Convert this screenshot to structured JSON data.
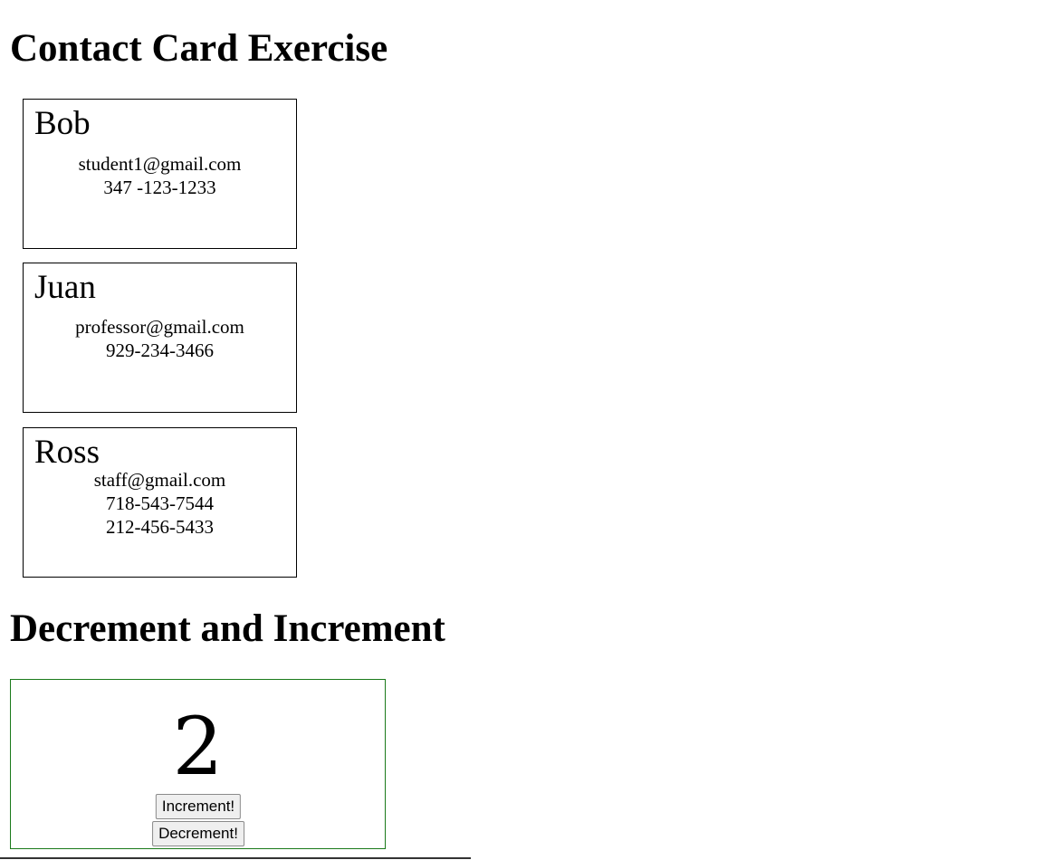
{
  "page_title": "Contact Card Exercise",
  "contacts": [
    {
      "name": "Bob",
      "lines": [
        "student1@gmail.com",
        "347 -123-1233"
      ]
    },
    {
      "name": "Juan",
      "lines": [
        "professor@gmail.com",
        "929-234-3466"
      ]
    },
    {
      "name": "Ross",
      "lines": [
        "staff@gmail.com",
        "718-543-7544",
        "212-456-5433"
      ]
    }
  ],
  "counter": {
    "title": "Decrement and Increment",
    "value": "2",
    "increment_label": "Increment!",
    "decrement_label": "Decrement!"
  }
}
